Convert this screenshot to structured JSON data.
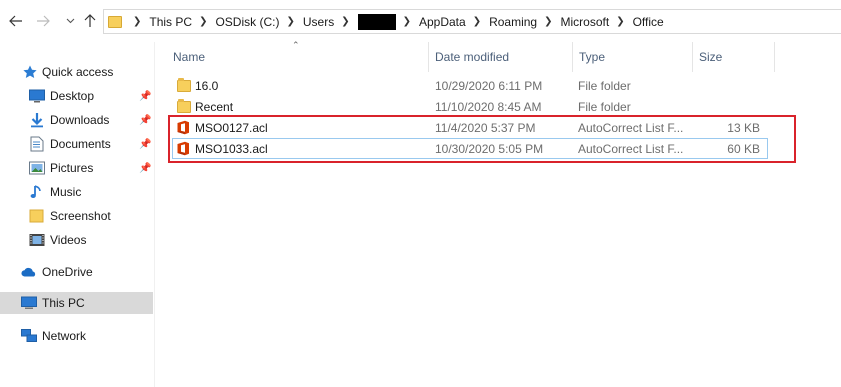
{
  "navigation": {
    "back_icon": "arrow-left-icon",
    "forward_icon": "arrow-right-icon",
    "recent_icon": "chevron-down-icon",
    "up_icon": "arrow-up-icon"
  },
  "address_bar": {
    "crumbs": [
      "This PC",
      "OSDisk (C:)",
      "Users",
      "AppData",
      "Roaming",
      "Microsoft",
      "Office"
    ]
  },
  "sidebar": {
    "quick_access": "Quick access",
    "items": [
      {
        "label": "Desktop",
        "icon": "desktop-icon",
        "pinned": true
      },
      {
        "label": "Downloads",
        "icon": "downloads-icon",
        "pinned": true
      },
      {
        "label": "Documents",
        "icon": "documents-icon",
        "pinned": true
      },
      {
        "label": "Pictures",
        "icon": "pictures-icon",
        "pinned": true
      },
      {
        "label": "Music",
        "icon": "music-icon",
        "pinned": false
      },
      {
        "label": "Screenshot",
        "icon": "folder-icon",
        "pinned": false
      },
      {
        "label": "Videos",
        "icon": "videos-icon",
        "pinned": false
      }
    ],
    "onedrive": "OneDrive",
    "this_pc": "This PC",
    "network": "Network"
  },
  "columns": {
    "name": "Name",
    "date": "Date modified",
    "type": "Type",
    "size": "Size"
  },
  "files": [
    {
      "name": "16.0",
      "date": "10/29/2020 6:11 PM",
      "type": "File folder",
      "size": "",
      "icon": "folder-icon"
    },
    {
      "name": "Recent",
      "date": "11/10/2020 8:45 AM",
      "type": "File folder",
      "size": "",
      "icon": "folder-icon"
    },
    {
      "name": "MSO0127.acl",
      "date": "11/4/2020 5:37 PM",
      "type": "AutoCorrect List F...",
      "size": "13 KB",
      "icon": "office-icon"
    },
    {
      "name": "MSO1033.acl",
      "date": "10/30/2020 5:05 PM",
      "type": "AutoCorrect List F...",
      "size": "60 KB",
      "icon": "office-icon"
    }
  ],
  "colors": {
    "highlight": "#d9232b",
    "selected_nav": "#d9d9d9",
    "focus_border": "#99c9ef",
    "office_red": "#d83b01"
  }
}
